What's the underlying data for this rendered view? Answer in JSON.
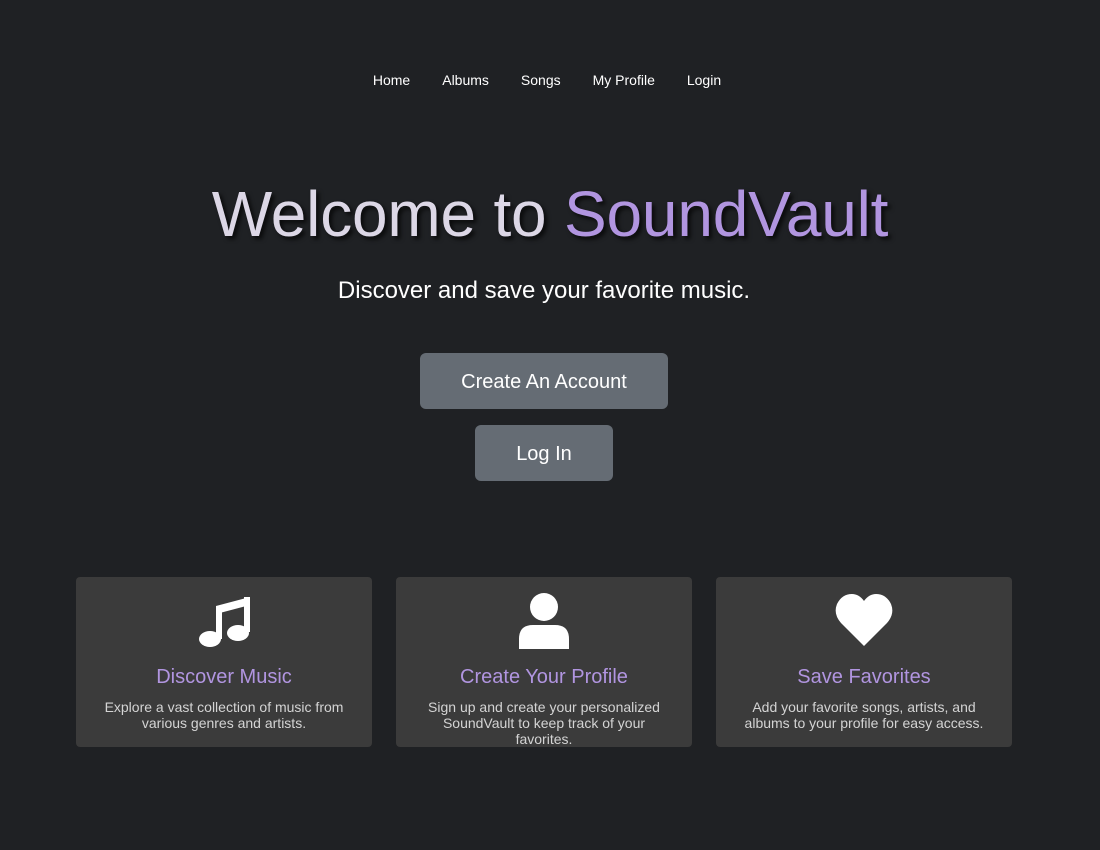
{
  "nav": {
    "items": [
      {
        "label": "Home"
      },
      {
        "label": "Albums"
      },
      {
        "label": "Songs"
      },
      {
        "label": "My Profile"
      },
      {
        "label": "Login"
      }
    ]
  },
  "hero": {
    "title_prefix": "Welcome to ",
    "title_brand": "SoundVault",
    "subtitle": "Discover and save your favorite music.",
    "create_account_label": "Create An Account",
    "login_label": "Log In"
  },
  "features": [
    {
      "icon": "music-note-icon",
      "title": "Discover Music",
      "description": "Explore a vast collection of music from various genres and artists."
    },
    {
      "icon": "user-icon",
      "title": "Create Your Profile",
      "description": "Sign up and create your personalized SoundVault to keep track of your favorites."
    },
    {
      "icon": "heart-icon",
      "title": "Save Favorites",
      "description": "Add your favorite songs, artists, and albums to your profile for easy access."
    }
  ],
  "colors": {
    "background": "#1f2124",
    "accent": "#b195e0",
    "button": "#656c74",
    "card": "#3b3b3b"
  }
}
